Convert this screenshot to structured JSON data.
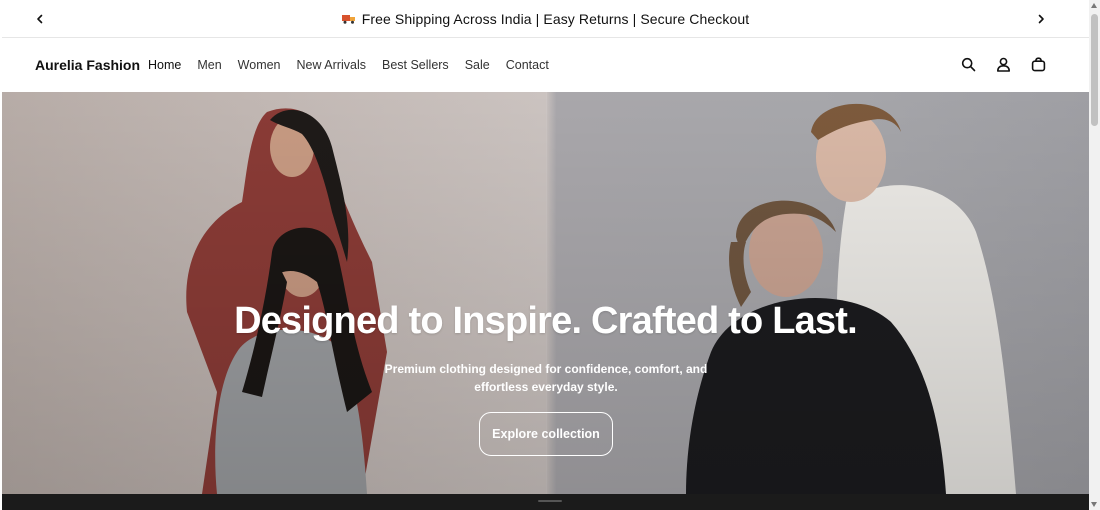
{
  "announcement": {
    "text": "Free Shipping Across India | Easy Returns | Secure Checkout",
    "icon": "truck-icon",
    "prev_icon": "chevron-left-icon",
    "next_icon": "chevron-right-icon"
  },
  "header": {
    "brand": "Aurelia Fashion",
    "nav": [
      {
        "label": "Home"
      },
      {
        "label": "Men"
      },
      {
        "label": "Women"
      },
      {
        "label": "New Arrivals"
      },
      {
        "label": "Best Sellers"
      },
      {
        "label": "Sale"
      },
      {
        "label": "Contact"
      }
    ],
    "icons": [
      "search-icon",
      "account-icon",
      "cart-icon"
    ]
  },
  "hero": {
    "title": "Designed to Inspire. Crafted to Last.",
    "subtitle": "Premium clothing designed for confidence, comfort, and effortless everyday style.",
    "cta_label": "Explore collection"
  },
  "colors": {
    "text": "#111111",
    "hero_text": "#ffffff",
    "bottom_bar": "#1b1b1b"
  }
}
